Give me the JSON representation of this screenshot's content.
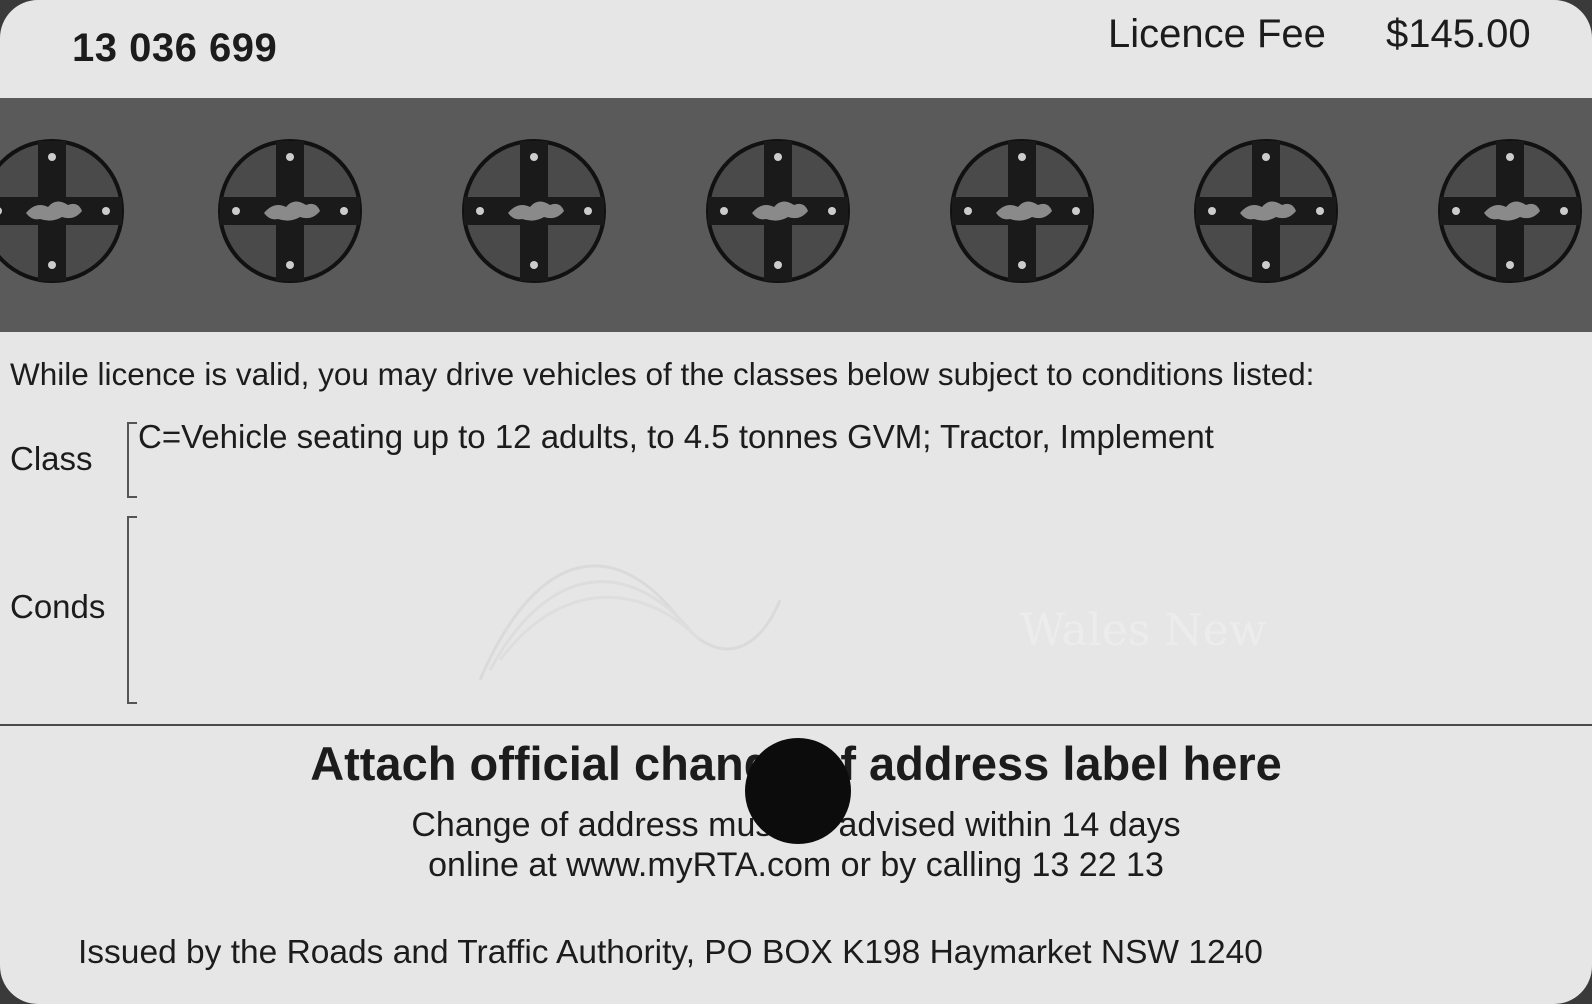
{
  "header": {
    "card_number": "13 036 699",
    "fee_label": "Licence Fee",
    "fee_amount": "$145.00"
  },
  "band": {
    "emblem_icon": "nsw-cross-lion-emblem-icon",
    "emblem_count": 7,
    "band_color": "#5a5a5a"
  },
  "body": {
    "intro": "While licence is valid, you may drive vehicles of the classes below subject to conditions listed:",
    "class_label": "Class",
    "class_value": "C=Vehicle seating up to 12 adults, to 4.5 tonnes GVM; Tractor, Implement",
    "conds_label": "Conds",
    "conds_value": "",
    "watermark_text": "Wales New"
  },
  "address": {
    "heading": "Attach official change of address label here",
    "line1": "Change of address must be advised within 14 days",
    "line2": "online at www.myRTA.com or by calling 13 22 13"
  },
  "footer": {
    "issuer": "Issued by the Roads and Traffic Authority, PO BOX K198 Haymarket NSW 1240"
  }
}
